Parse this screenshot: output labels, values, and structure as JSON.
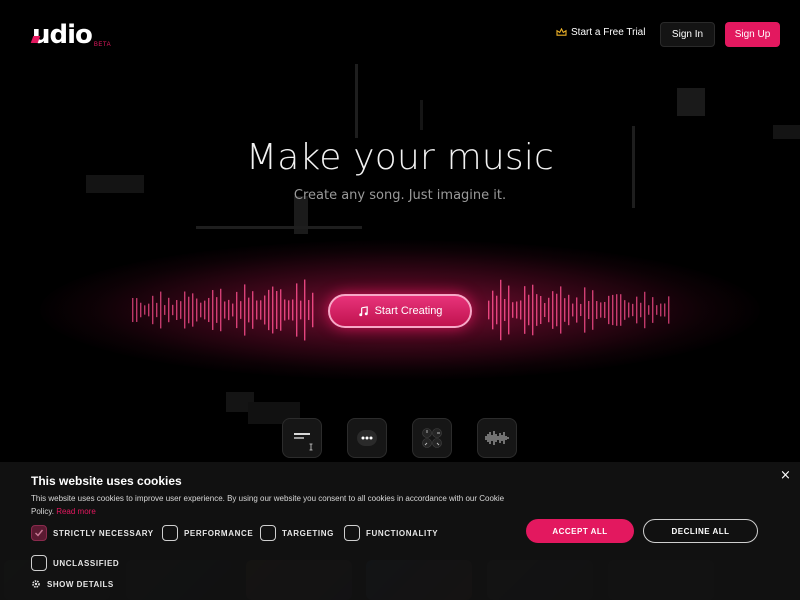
{
  "header": {
    "logo_text": "udio",
    "logo_badge": "BETA",
    "trial_label": "Start a Free Trial",
    "trial_icon": "crown-icon",
    "signin_label": "Sign In",
    "signup_label": "Sign Up"
  },
  "hero": {
    "title": "Make your music",
    "subtitle": "Create any song. Just imagine it.",
    "cta_label": "Start Creating",
    "cta_icon": "music-note-icon"
  },
  "tools": [
    {
      "icon": "lyrics-editor-icon"
    },
    {
      "icon": "more-options-icon"
    },
    {
      "icon": "controls-knobs-icon"
    },
    {
      "icon": "waveform-icon"
    }
  ],
  "cookie": {
    "title": "This website uses cookies",
    "body": "This website uses cookies to improve user experience. By using our website you consent to all cookies in accordance with our Cookie Policy.",
    "read_more": "Read more",
    "options": [
      {
        "label": "STRICTLY NECESSARY",
        "checked": true
      },
      {
        "label": "PERFORMANCE",
        "checked": false
      },
      {
        "label": "TARGETING",
        "checked": false
      },
      {
        "label": "FUNCTIONALITY",
        "checked": false
      },
      {
        "label": "UNCLASSIFIED",
        "checked": false
      }
    ],
    "accept_label": "ACCEPT ALL",
    "decline_label": "DECLINE ALL",
    "details_label": "SHOW DETAILS",
    "close_label": "×"
  },
  "colors": {
    "accent": "#e3185f",
    "background": "#000000"
  }
}
